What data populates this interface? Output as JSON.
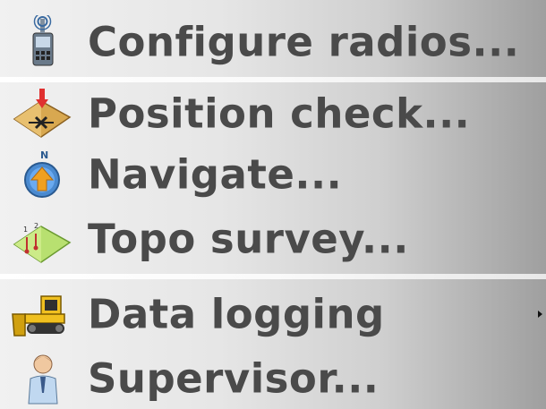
{
  "menu": {
    "items": [
      {
        "label": "Configure radios...",
        "icon": "radio-icon"
      },
      {
        "label": "Position check...",
        "icon": "position-check-icon"
      },
      {
        "label": "Navigate...",
        "icon": "navigate-icon"
      },
      {
        "label": "Topo survey...",
        "icon": "topo-survey-icon"
      },
      {
        "label": "Data logging",
        "icon": "bulldozer-icon",
        "has_submenu": true
      },
      {
        "label": "Supervisor...",
        "icon": "supervisor-icon"
      }
    ]
  },
  "colors": {
    "label_text": "#4a4a4a",
    "gradient_start": "#f1f1f1",
    "gradient_end": "#9f9f9f",
    "separator": "#ffffff"
  }
}
